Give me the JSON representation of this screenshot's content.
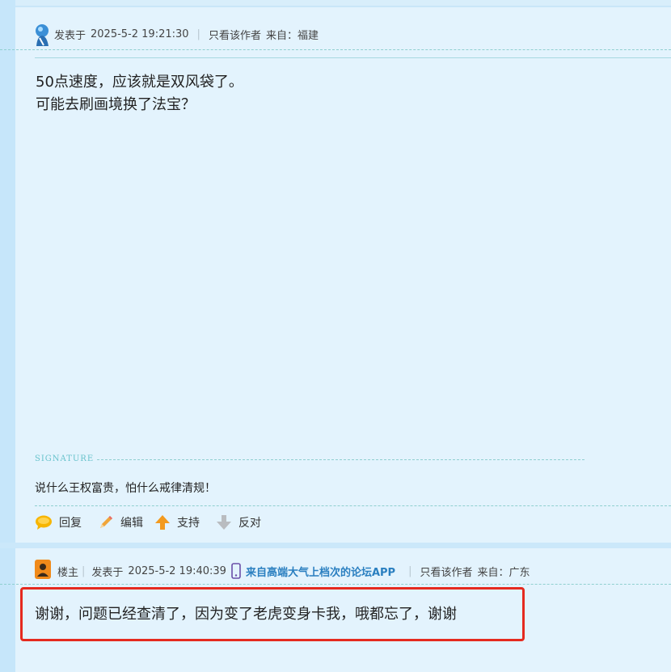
{
  "post1": {
    "posted_prefix": "发表于",
    "posted_time": "2025-5-2 19:21:30",
    "separator": "|",
    "author_only": "只看该作者",
    "from_label": "来自：",
    "from_location": "福建",
    "content_lines": [
      "50点速度，应该就是双风袋了。",
      "可能去刷画境换了法宝？"
    ],
    "signature_label": "SIGNATURE",
    "signature_text": "说什么王权富贵，怕什么戒律清规！",
    "actions": {
      "reply": "回复",
      "edit": "编辑",
      "support": "支持",
      "oppose": "反对"
    }
  },
  "post2": {
    "role_badge": "楼主",
    "separator": "|",
    "posted_prefix": "发表于",
    "posted_time": "2025-5-2 19:40:39",
    "app_link": "来自高端大气上档次的论坛APP",
    "author_only": "只看该作者",
    "from_label": "来自：",
    "from_location": "广东",
    "content": "谢谢，问题已经查清了，因为变了老虎变身卡我，哦都忘了，谢谢"
  },
  "colors": {
    "highlight_box": "#e52a1f",
    "link": "#2a7fc0",
    "signature": "#69c3cc"
  },
  "icons": [
    "user-avatar-icon",
    "owner-avatar-icon",
    "reply-bubble-icon",
    "pencil-icon",
    "up-arrow-icon",
    "down-arrow-icon",
    "phone-icon"
  ]
}
